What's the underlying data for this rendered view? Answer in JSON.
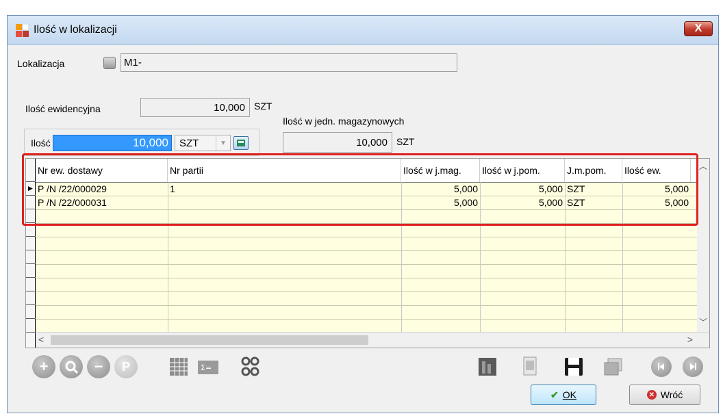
{
  "window": {
    "title": "Ilość w lokalizacji",
    "close_label": "X"
  },
  "lokalizacja": {
    "label": "Lokalizacja",
    "value": "M1-"
  },
  "ilosc_ewidencyjna": {
    "label": "Ilość ewidencyjna",
    "value": "10,000",
    "unit": "SZT"
  },
  "ilosc_jedn_mag": {
    "label": "Ilość w jedn. magazynowych",
    "value": "10,000",
    "unit": "SZT"
  },
  "ilosc": {
    "label": "Ilość",
    "value": "10,000",
    "unit": "SZT"
  },
  "grid": {
    "columns": [
      "Nr ew. dostawy",
      "Nr partii",
      "Ilość w j.mag.",
      "Ilość w j.pom.",
      "J.m.pom.",
      "Ilość ew."
    ],
    "rows": [
      [
        "P /N  /22/000029",
        "1",
        "5,000",
        "5,000",
        "SZT",
        "5,000"
      ],
      [
        "P /N  /22/000031",
        "",
        "5,000",
        "5,000",
        "SZT",
        "5,000"
      ]
    ]
  },
  "toolbar": {
    "icons": [
      "add-icon",
      "search-icon",
      "remove-icon",
      "p-icon",
      "grid-icon",
      "sum-icon",
      "gears-icon",
      "book-icon",
      "document-icon",
      "save-icon",
      "copy-icon",
      "prev-icon",
      "next-icon"
    ],
    "p_label": "P"
  },
  "buttons": {
    "ok_label": "OK",
    "cancel_label": "Wróć"
  },
  "colors": {
    "grid_bg": "#fffee0",
    "highlight_frame": "#e02020",
    "selection": "#3399ff"
  }
}
